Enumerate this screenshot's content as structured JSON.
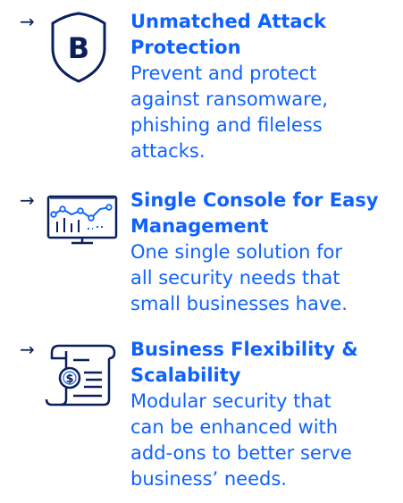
{
  "accent_color": "#0f62fe",
  "icon_color": "#0a1f5c",
  "features": [
    {
      "arrow": "→",
      "icon": "shield-b-icon",
      "badge_letter": "B",
      "title_lines": [
        "Unmatched Attack",
        "Protection"
      ],
      "desc_lines": [
        "Prevent and protect",
        "against ransomware,",
        "phishing and fileless",
        "attacks."
      ]
    },
    {
      "arrow": "→",
      "icon": "monitor-chart-icon",
      "title_lines": [
        "Single Console for Easy",
        "Management"
      ],
      "desc_lines": [
        "One single solution for",
        "all security needs that",
        "small businesses have."
      ]
    },
    {
      "arrow": "→",
      "icon": "invoice-scroll-icon",
      "title_lines": [
        "Business Flexibility &",
        "Scalability"
      ],
      "desc_lines": [
        "Modular security that",
        "can be enhanced with",
        "add-ons to better serve",
        "business’ needs."
      ]
    }
  ]
}
